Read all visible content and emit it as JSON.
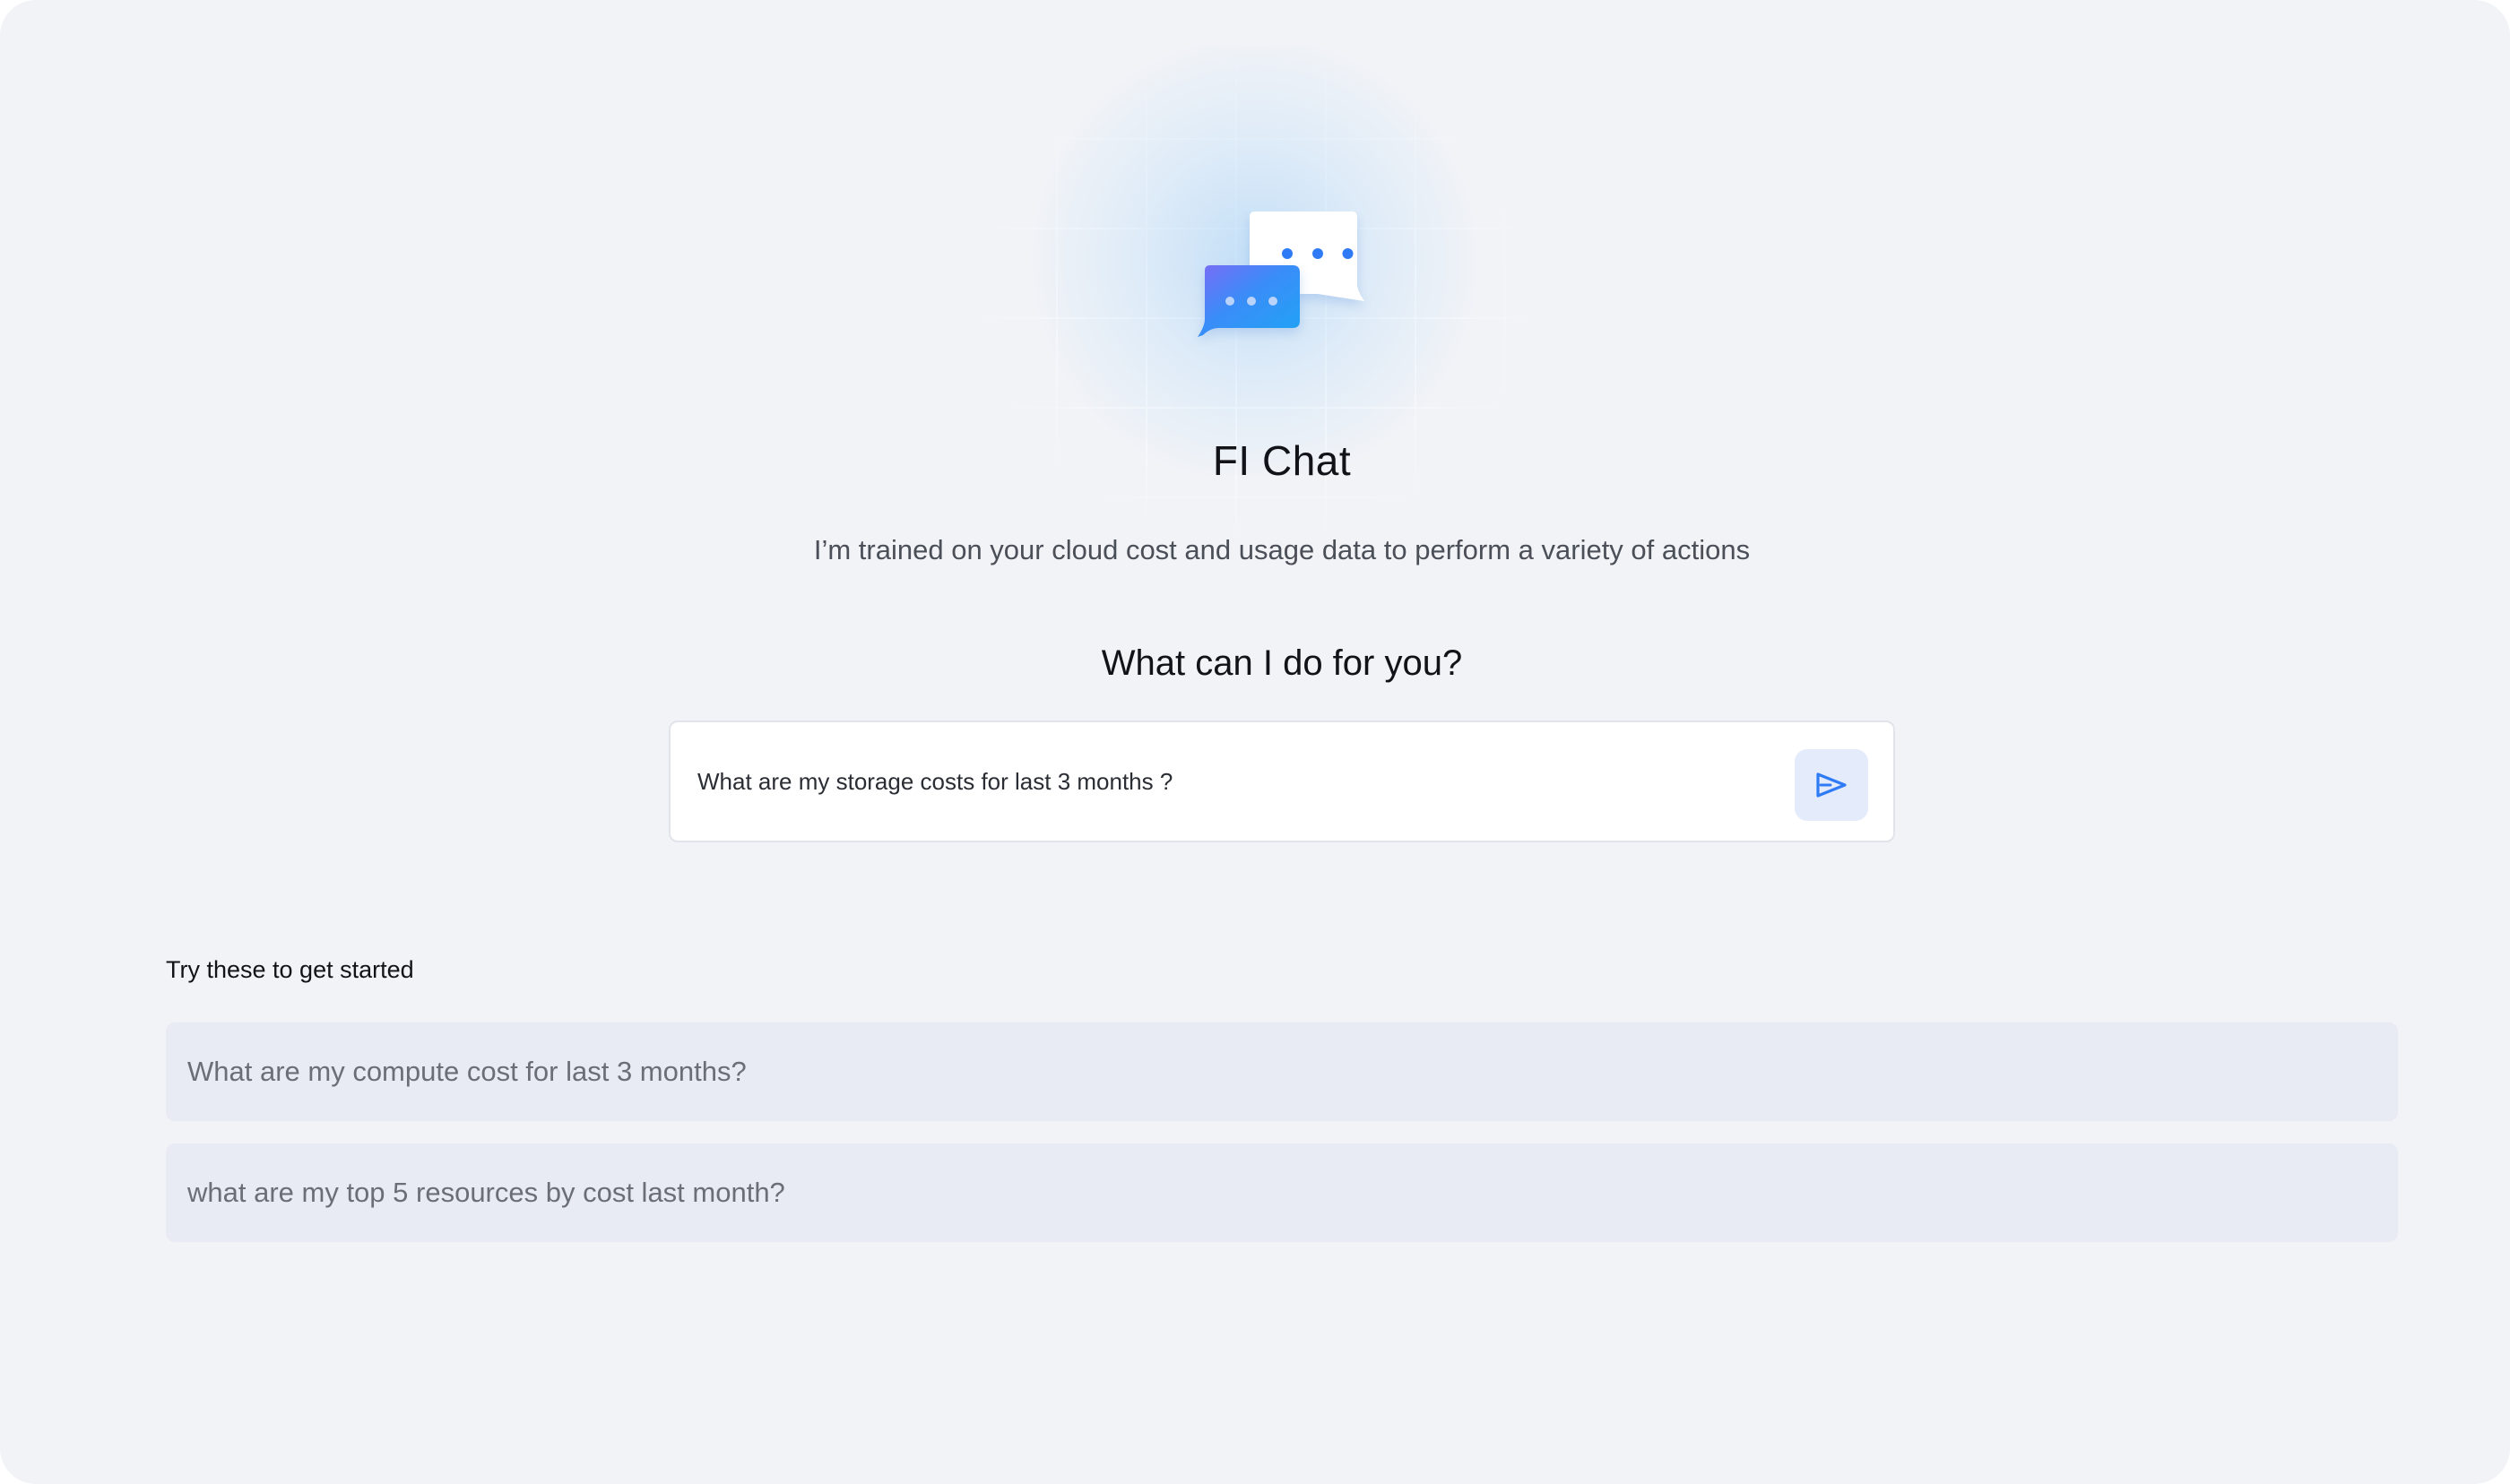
{
  "app": {
    "title": "FI Chat",
    "subtitle": "I’m trained on your cloud cost and usage data to perform a variety of actions",
    "prompt_heading": "What can I do for you?"
  },
  "chat_input": {
    "value": "What are my storage costs for last 3 months ?",
    "send_icon": "send-icon"
  },
  "suggestions": {
    "label": "Try these to get started",
    "items": [
      "What are my compute cost for last 3 months?",
      "what are my top 5 resources by cost last month?"
    ]
  },
  "colors": {
    "background": "#f1f3f7",
    "accent": "#2f7bf5",
    "suggestion_bg": "#e8ebf3",
    "send_bg": "#e4ebfb"
  },
  "icons": {
    "logo": "chat-bubbles-icon"
  }
}
